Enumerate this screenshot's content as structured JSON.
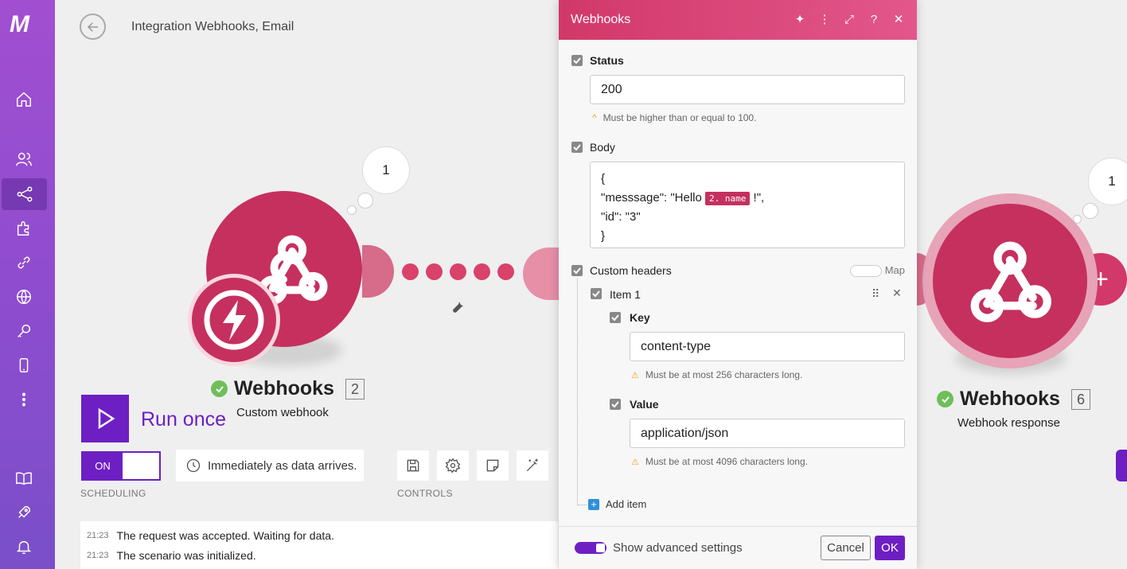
{
  "header": {
    "title": "Integration Webhooks, Email"
  },
  "sidebar": {
    "items": [
      {
        "name": "home-icon"
      },
      {
        "name": "team-icon"
      },
      {
        "name": "scenarios-icon"
      },
      {
        "name": "apps-icon"
      },
      {
        "name": "connections-icon"
      },
      {
        "name": "webhooks-icon"
      },
      {
        "name": "keys-icon"
      },
      {
        "name": "devices-icon"
      },
      {
        "name": "more-icon"
      },
      {
        "name": "docs-icon"
      },
      {
        "name": "whats-new-icon"
      },
      {
        "name": "notifications-icon"
      }
    ]
  },
  "modules": {
    "left": {
      "bubble": "1",
      "name": "Webhooks",
      "count": "2",
      "subtitle": "Custom webhook"
    },
    "right": {
      "bubble": "1",
      "name": "Webhooks",
      "count": "6",
      "subtitle": "Webhook response"
    }
  },
  "controls": {
    "run_label": "Run once",
    "toggle_label": "ON",
    "schedule_text": "Immediately as data arrives.",
    "scheduling_label": "SCHEDULING",
    "controls_label": "CONTROLS"
  },
  "log": [
    {
      "time": "21:23",
      "text": "The request was accepted. Waiting for data."
    },
    {
      "time": "21:23",
      "text": "The scenario was initialized."
    }
  ],
  "dialog": {
    "title": "Webhooks",
    "status": {
      "label": "Status",
      "value": "200",
      "hint": "Must be higher than or equal to 100."
    },
    "body": {
      "label": "Body",
      "line1": "{",
      "line2_pre": "\"messsage\": \"Hello ",
      "pill": "2. name",
      "line2_post": " !\",",
      "line3": "\"id\": \"3\"",
      "line4": "}"
    },
    "headers": {
      "label": "Custom headers",
      "map_label": "Map",
      "item_label": "Item 1"
    },
    "key": {
      "label": "Key",
      "value": "content-type",
      "hint": "Must be at most 256 characters long."
    },
    "value": {
      "label": "Value",
      "value": "application/json",
      "hint": "Must be at most 4096 characters long."
    },
    "add_item": "Add item",
    "advanced_label": "Show advanced settings",
    "cancel_label": "Cancel",
    "ok_label": "OK"
  },
  "colors": {
    "accent": "#6d1fc4",
    "module": "#c5305f",
    "header": "#d2386a"
  }
}
